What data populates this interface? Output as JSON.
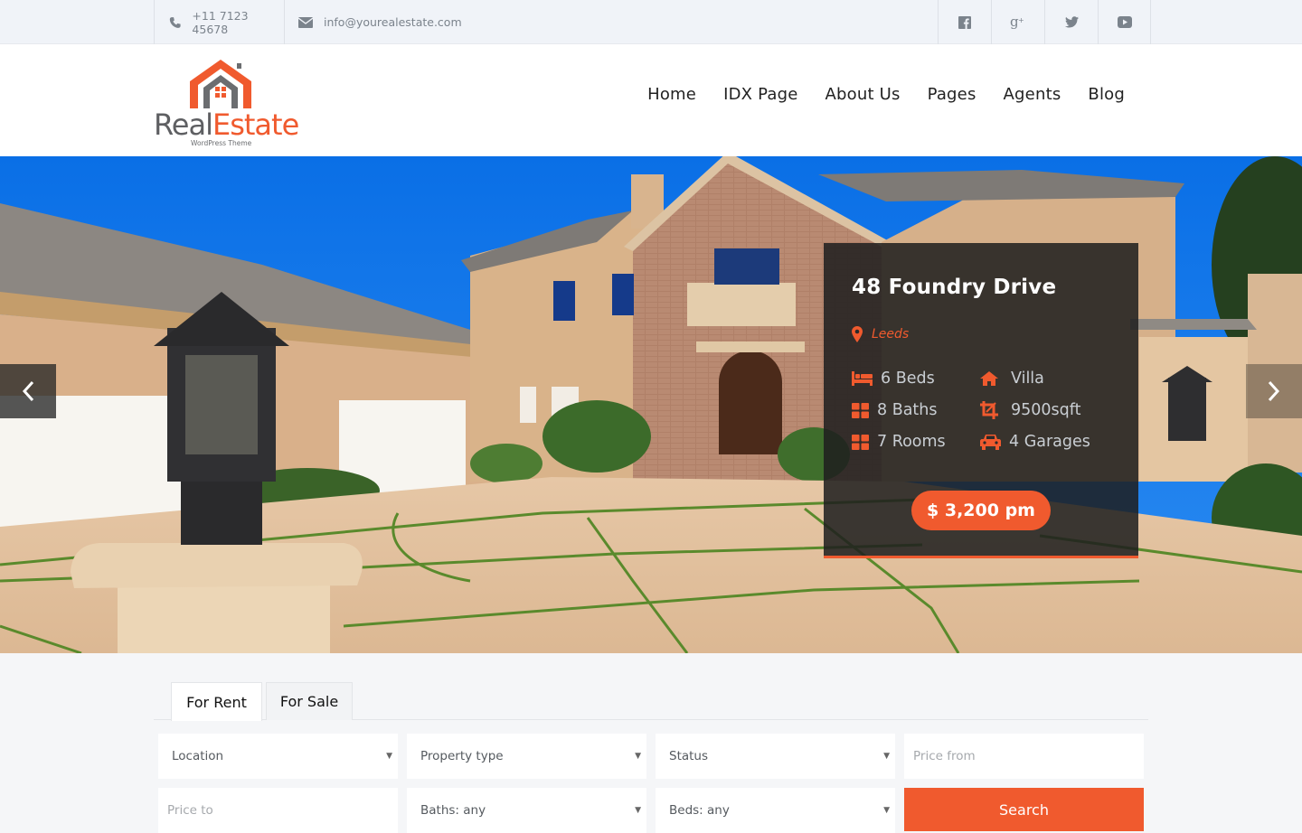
{
  "topbar": {
    "phone": "+11 7123 45678",
    "email": "info@yourealestate.com",
    "social": [
      {
        "name": "facebook",
        "icon": "facebook-icon"
      },
      {
        "name": "google-plus",
        "icon": "google-plus-icon"
      },
      {
        "name": "twitter",
        "icon": "twitter-icon"
      },
      {
        "name": "youtube",
        "icon": "youtube-icon"
      }
    ]
  },
  "header": {
    "logo": {
      "part1": "Real",
      "part2": "Estate",
      "tagline": "WordPress Theme"
    },
    "nav": [
      "Home",
      "IDX Page",
      "About Us",
      "Pages",
      "Agents",
      "Blog"
    ]
  },
  "hero": {
    "property": {
      "title": "48 Foundry Drive",
      "location": "Leeds",
      "features_left": [
        {
          "icon": "bed-icon",
          "label": "6 Beds"
        },
        {
          "icon": "bath-grid-icon",
          "label": "8 Baths"
        },
        {
          "icon": "rooms-grid-icon",
          "label": "7 Rooms"
        }
      ],
      "features_right": [
        {
          "icon": "home-icon",
          "label": "Villa"
        },
        {
          "icon": "crop-area-icon",
          "label": "9500sqft"
        },
        {
          "icon": "car-icon",
          "label": "4 Garages"
        }
      ],
      "price": "$ 3,200 pm"
    }
  },
  "search": {
    "tabs": [
      "For Rent",
      "For Sale"
    ],
    "active_tab": "For Rent",
    "fields": {
      "location": "Location",
      "property_type": "Property type",
      "status": "Status",
      "price_from_placeholder": "Price from",
      "price_to_placeholder": "Price to",
      "baths": "Baths: any",
      "beds": "Beds: any"
    },
    "button": "Search"
  },
  "colors": {
    "accent": "#f05a2e",
    "topbar_bg": "#f0f3f8",
    "card_bg": "#1e1e1e"
  }
}
